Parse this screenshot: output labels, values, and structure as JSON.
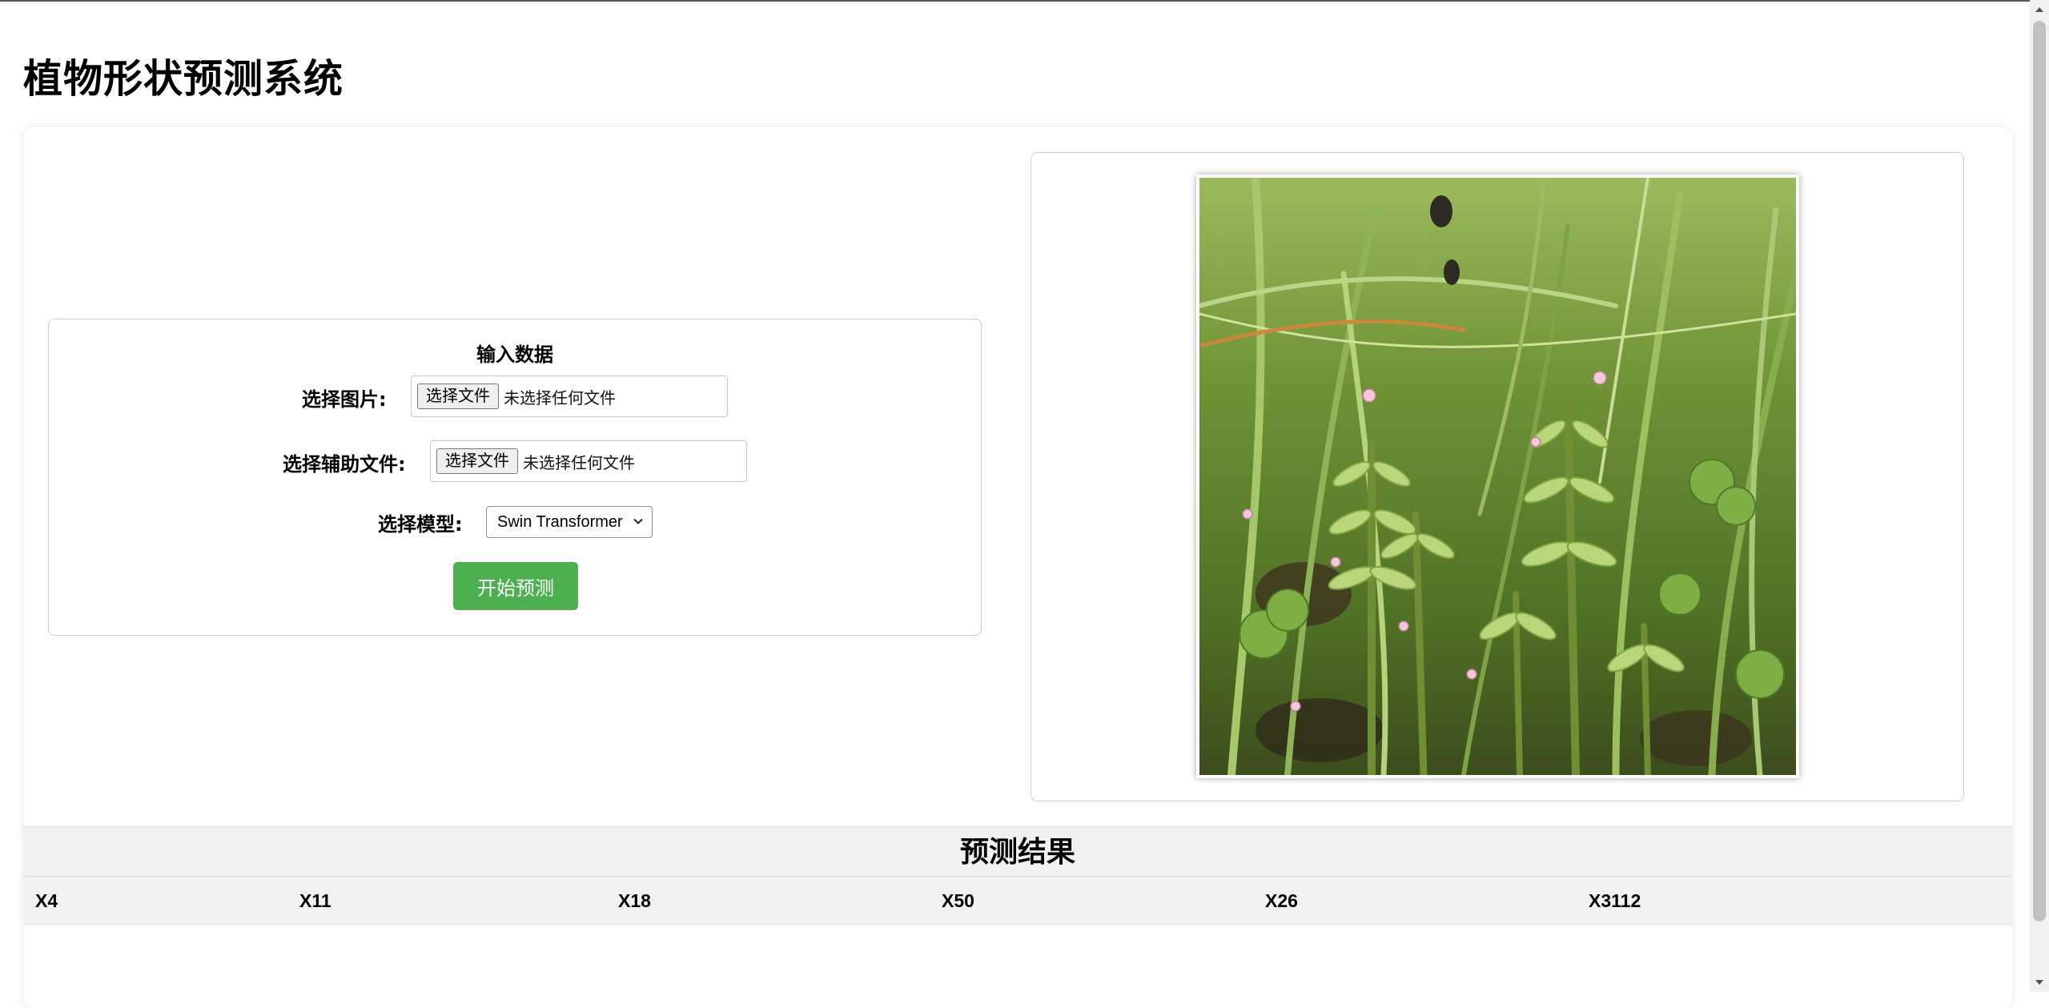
{
  "page": {
    "title": "植物形状预测系统"
  },
  "input_panel": {
    "section_title": "输入数据",
    "image_field": {
      "label": "选择图片:",
      "button_label": "选择文件",
      "status": "未选择任何文件"
    },
    "aux_field": {
      "label": "选择辅助文件:",
      "button_label": "选择文件",
      "status": "未选择任何文件"
    },
    "model_field": {
      "label": "选择模型:",
      "selected": "Swin Transformer"
    },
    "predict_button": "开始预测"
  },
  "image_panel": {
    "photo": "plant-photo"
  },
  "results": {
    "title": "预测结果",
    "columns": [
      "X4",
      "X11",
      "X18",
      "X50",
      "X26",
      "X3112"
    ]
  },
  "colors": {
    "accent_green": "#4caf50",
    "results_header_bg": "#f0f0f0"
  }
}
